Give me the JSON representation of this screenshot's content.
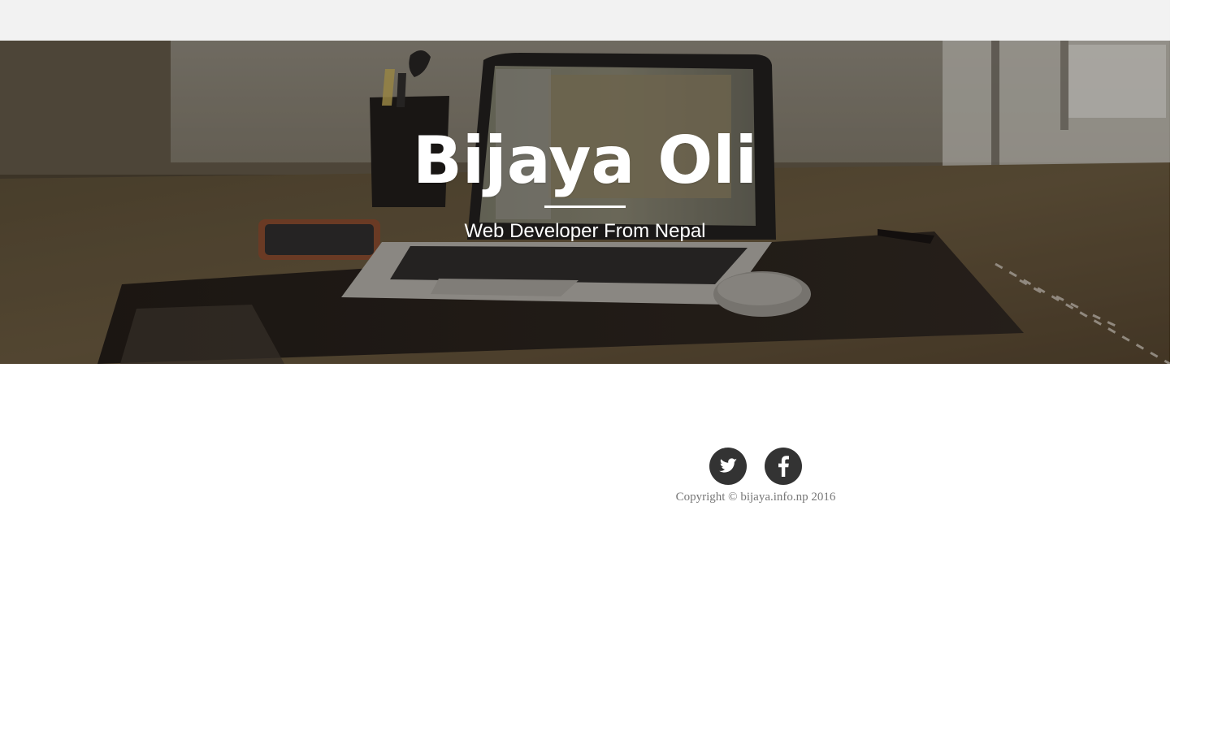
{
  "hero": {
    "title": "Bijaya Oli",
    "subtitle": "Web Developer From Nepal"
  },
  "footer": {
    "social": [
      {
        "name": "twitter",
        "icon": "twitter-icon"
      },
      {
        "name": "facebook",
        "icon": "facebook-icon"
      }
    ],
    "copyright": "Copyright © bijaya.info.np 2016"
  },
  "colors": {
    "topbar_bg": "#f2f2f2",
    "social_bg": "#333333",
    "copyright_text": "#777777",
    "hero_text": "#ffffff"
  }
}
